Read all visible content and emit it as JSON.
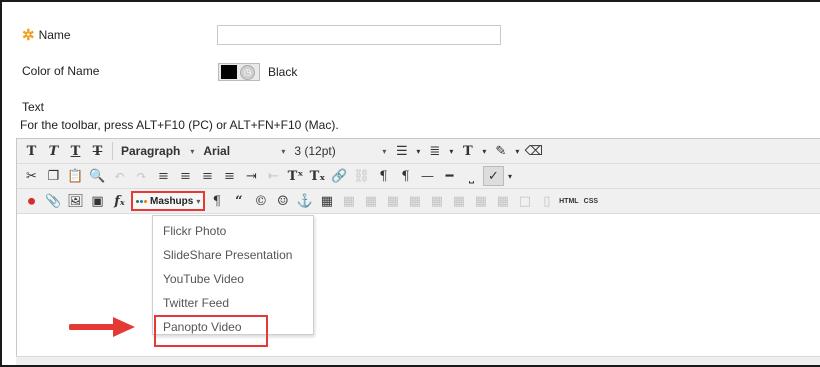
{
  "form": {
    "name_label": "Name",
    "required_marker": "✲",
    "name_value": "",
    "color_label": "Color of Name",
    "color_value": "Black",
    "color_hex": "#000000",
    "text_label": "Text",
    "toolbar_hint": "For the toolbar, press ALT+F10 (PC) or ALT+FN+F10 (Mac)."
  },
  "toolbar": {
    "paragraph": "Paragraph",
    "font": "Arial",
    "size": "3 (12pt)",
    "mashups": "Mashups",
    "html": "HTML",
    "css": "CSS"
  },
  "mashups_menu": {
    "items": [
      "Flickr Photo",
      "SlideShare Presentation",
      "YouTube Video",
      "Twitter Feed",
      "Panopto Video"
    ]
  },
  "colors": {
    "required": "#f0a020",
    "highlight": "#e53935",
    "arrow": "#e53935"
  }
}
